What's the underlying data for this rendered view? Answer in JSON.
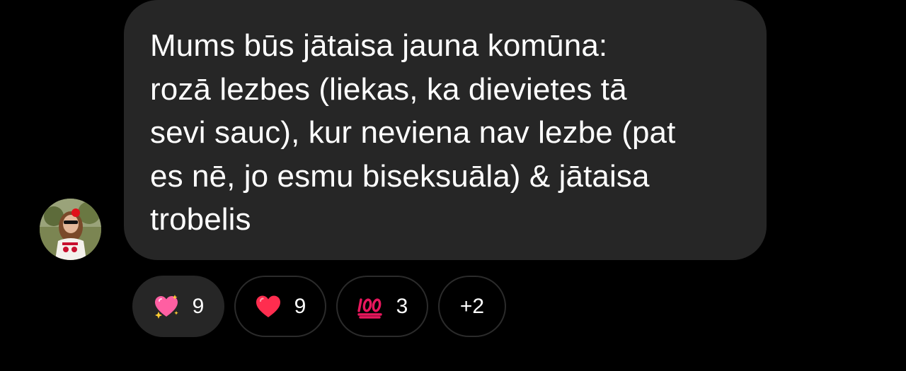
{
  "message": {
    "lines": [
      "Mums būs jātaisa jauna komūna:",
      "rozā lezbes (liekas, ka dievietes tā",
      "sevi sauc),  kur neviena nav lezbe (pat",
      "es nē, jo esmu biseksuāla) & jātaisa",
      "trobelis"
    ]
  },
  "reactions": [
    {
      "icon": "sparkling-heart-icon",
      "count": "9",
      "active": true
    },
    {
      "icon": "red-heart-icon",
      "count": "9",
      "active": false
    },
    {
      "icon": "hundred-points-icon",
      "count": "3",
      "active": false
    },
    {
      "icon": "more-reactions",
      "count": "+2",
      "active": false
    }
  ],
  "colors": {
    "background": "#000000",
    "bubble": "#262626",
    "text": "#ffffff",
    "heart": "#ff2d55",
    "hundred": "#e8175d"
  }
}
